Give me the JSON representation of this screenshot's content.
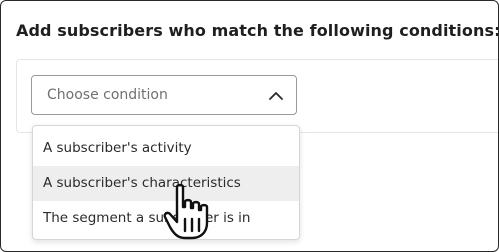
{
  "heading": "Add subscribers who match the following conditions:",
  "condition_select": {
    "placeholder": "Choose condition",
    "icon": "chevron-up-icon"
  },
  "menu": {
    "items": [
      {
        "label": "A subscriber's activity"
      },
      {
        "label": "A subscriber's characteristics",
        "highlighted": true
      },
      {
        "label": "The segment a subscriber is in"
      }
    ]
  },
  "cursor": {
    "icon": "hand-pointer-icon"
  },
  "colors": {
    "text": "#1f1f1f",
    "placeholder": "#707070",
    "border": "#9a9a9a",
    "highlight": "#eeeeee"
  }
}
